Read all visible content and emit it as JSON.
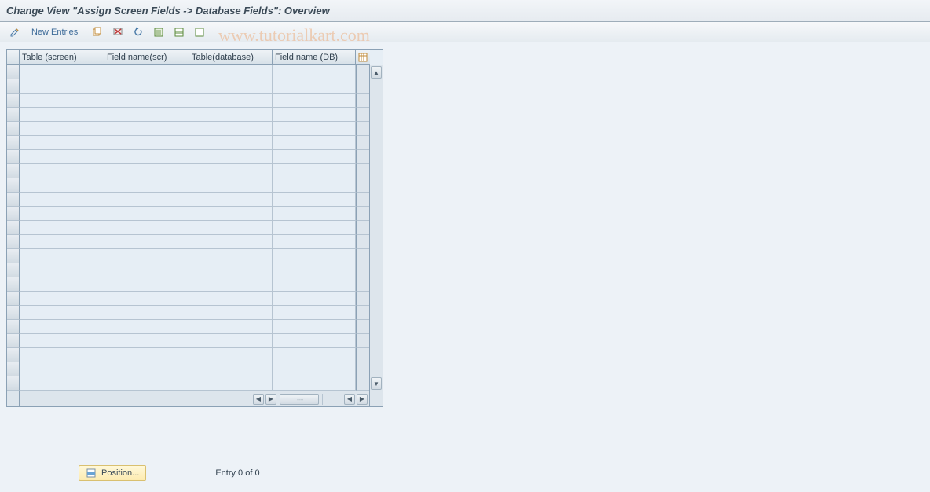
{
  "title": "Change View \"Assign Screen Fields -> Database Fields\": Overview",
  "toolbar": {
    "new_entries_label": "New Entries"
  },
  "table": {
    "headers": {
      "col1": "Table (screen)",
      "col2": "Field name(scr)",
      "col3": "Table(database)",
      "col4": "Field name (DB)"
    },
    "row_count": 23
  },
  "footer": {
    "position_label": "Position...",
    "entry_label": "Entry 0 of 0"
  },
  "watermark": "www.tutorialkart.com"
}
